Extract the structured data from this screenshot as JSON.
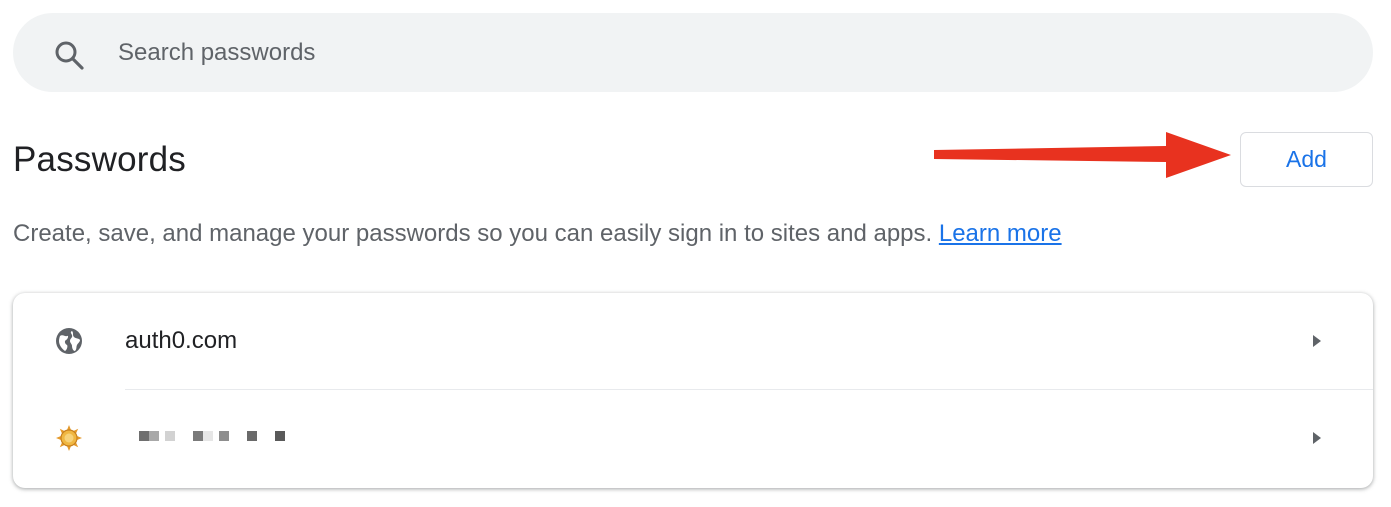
{
  "search": {
    "placeholder": "Search passwords",
    "value": "",
    "icon": "search-icon"
  },
  "header": {
    "title": "Passwords",
    "add_label": "Add"
  },
  "description": {
    "text": "Create, save, and manage your passwords so you can easily sign in to sites and apps. ",
    "link_label": "Learn more"
  },
  "passwords": {
    "items": [
      {
        "site": "auth0.com",
        "icon": "globe-icon"
      },
      {
        "site": "",
        "icon": "sun-favicon-icon",
        "redacted": true
      }
    ]
  },
  "colors": {
    "accent": "#1a73e8",
    "annotation_arrow": "#e8321f",
    "search_bg": "#f1f3f4",
    "text_primary": "#202124",
    "text_secondary": "#5f6368"
  }
}
